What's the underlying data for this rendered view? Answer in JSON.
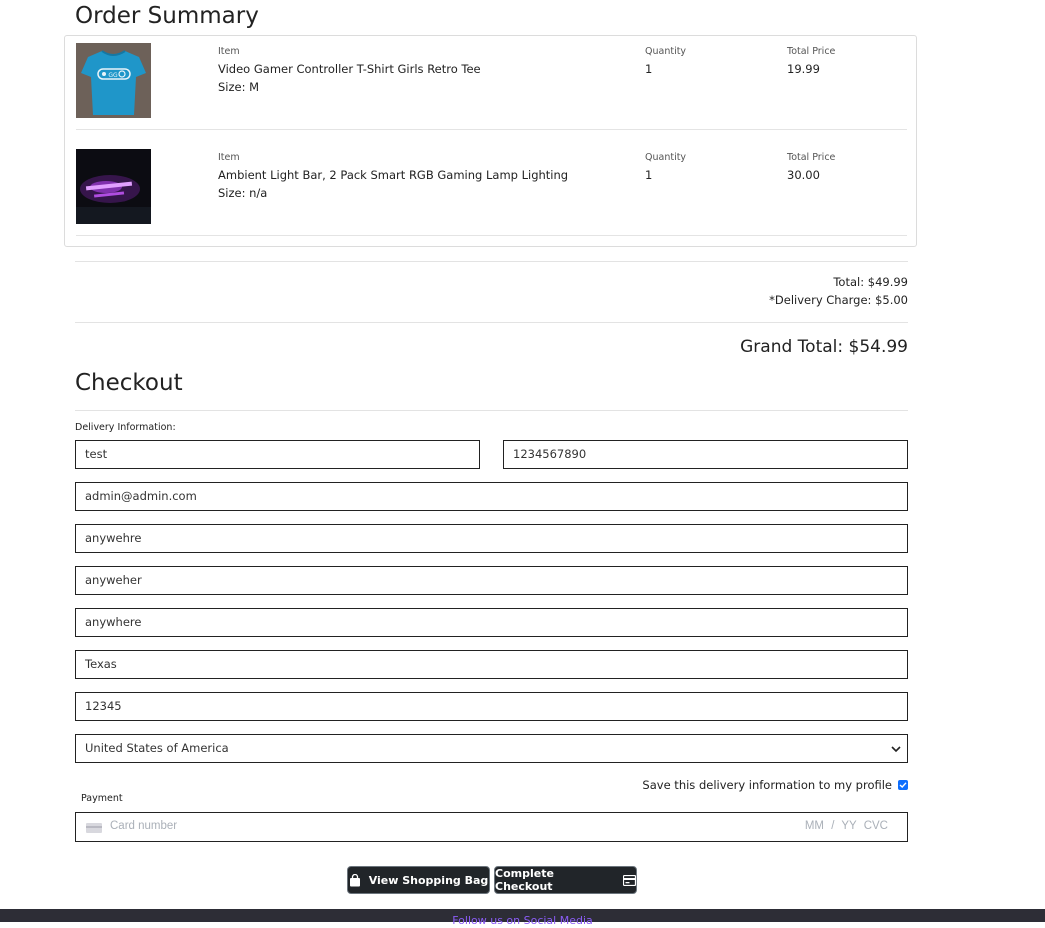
{
  "order_summary": {
    "title": "Order Summary",
    "items": [
      {
        "item_label": "Item",
        "name": "Video Gamer Controller T-Shirt Girls Retro Tee",
        "size": "Size: M",
        "quantity_label": "Quantity",
        "quantity": "1",
        "price_label": "Total Price",
        "price": "19.99"
      },
      {
        "item_label": "Item",
        "name": "Ambient Light Bar, 2 Pack Smart RGB Gaming Lamp Lighting",
        "size": "Size: n/a",
        "quantity_label": "Quantity",
        "quantity": "1",
        "price_label": "Total Price",
        "price": "30.00"
      }
    ],
    "total": "Total: $49.99",
    "delivery_charge": "*Delivery Charge: $5.00",
    "grand_total": "Grand Total: $54.99"
  },
  "checkout": {
    "title": "Checkout",
    "delivery_label": "Delivery Information:",
    "fields": {
      "full_name": "test",
      "phone": "1234567890",
      "email": "admin@admin.com",
      "address1": "anywehre",
      "address2": "anyweher",
      "city": "anywhere",
      "state": "Texas",
      "postcode": "12345",
      "country": "United States of America"
    },
    "save_info_label": "Save this delivery information to my profile",
    "save_info_checked": true,
    "payment_label": "Payment",
    "card_placeholder": "Card number",
    "card_expiry_cvc_placeholder": "MM / YY  CVC"
  },
  "buttons": {
    "view_bag": "View Shopping Bag",
    "complete": "Complete Checkout"
  },
  "footer": {
    "text": "Follow us on Social Media"
  },
  "colors": {
    "button_bg": "#212529",
    "checkbox": "#0d6efd",
    "footer_bg": "#2d2d36",
    "footer_link": "#8b5cf6"
  }
}
